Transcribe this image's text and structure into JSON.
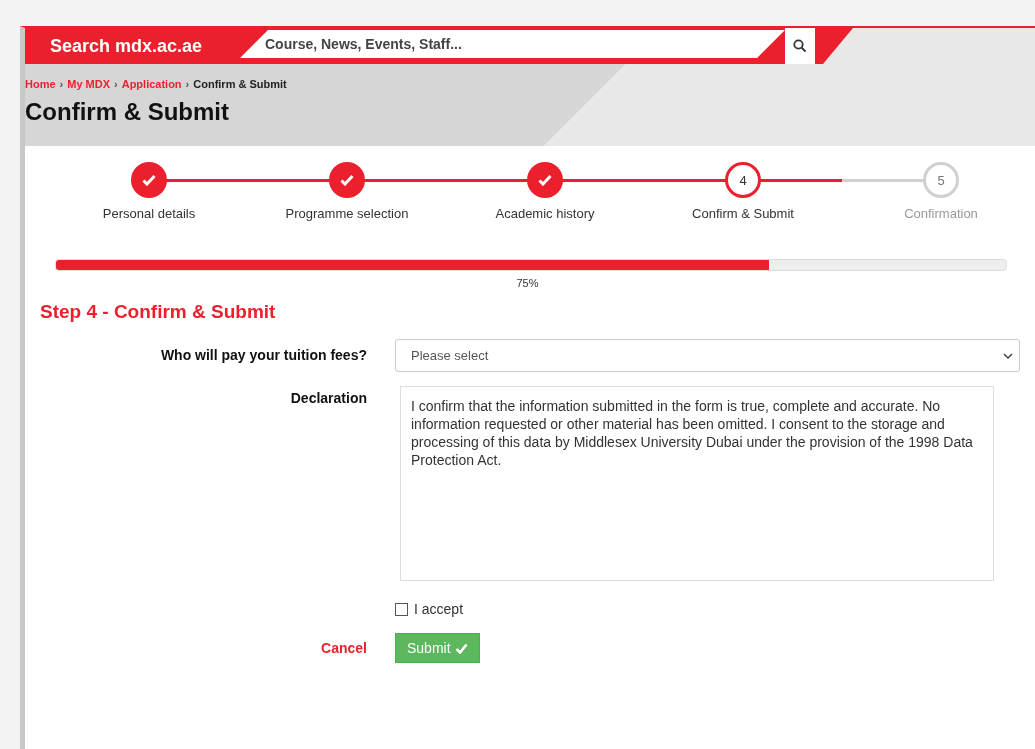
{
  "header": {
    "site_search_label": "Search mdx.ac.ae",
    "search_placeholder": "Course, News, Events, Staff..."
  },
  "breadcrumbs": [
    {
      "label": "Home",
      "separator": "›",
      "current": false
    },
    {
      "label": "My MDX",
      "separator": "›",
      "current": false
    },
    {
      "label": "Application",
      "separator": "›",
      "current": false
    },
    {
      "label": "Confirm & Submit",
      "current": true
    }
  ],
  "page_title": "Confirm & Submit",
  "steps": [
    {
      "label": "Personal details",
      "kind": "done"
    },
    {
      "label": "Programme selection",
      "kind": "done"
    },
    {
      "label": "Academic history",
      "kind": "done"
    },
    {
      "label": "Confirm & Submit",
      "number": "4",
      "kind": "current"
    },
    {
      "label": "Confirmation",
      "number": "5",
      "kind": "pending"
    }
  ],
  "progress": {
    "level": 0.75,
    "reading": "75%"
  },
  "section_title": "Step 4 - Confirm & Submit",
  "form": {
    "fees_label": "Who will pay your tuition fees?",
    "fees_select": "Please select",
    "declaration_label": "Declaration",
    "declaration_text": "I confirm that the information submitted in the form is true, complete and accurate. No information requested or other material has been omitted. I consent to the storage and processing of this data by Middlesex University Dubai under the provision of the 1998 Data Protection Act.",
    "accept": {
      "label": "I accept",
      "checked": false
    }
  },
  "buttons": {
    "cancel": "Cancel",
    "submit": "Submit"
  }
}
